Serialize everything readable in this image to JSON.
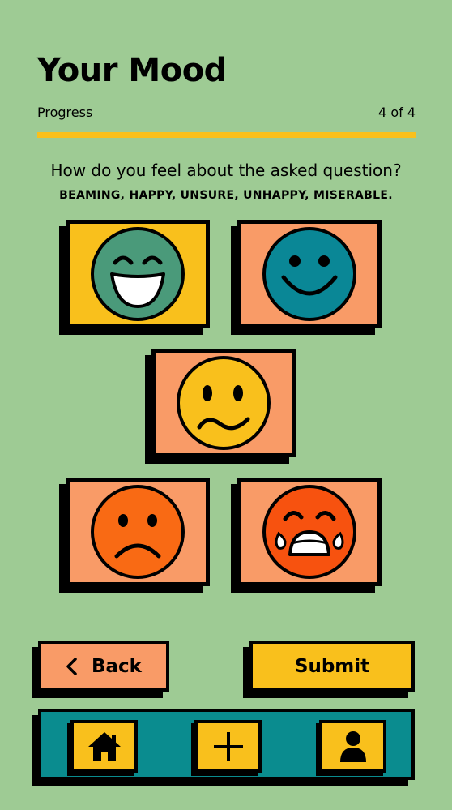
{
  "header": {
    "title": "Your Mood",
    "progress_label": "Progress",
    "progress_text": "4 of 4",
    "progress_fraction": 1.0
  },
  "question": {
    "text": "How do you feel about the asked question?",
    "options_hint": "BEAMING, HAPPY, UNSURE, UNHAPPY, MISERABLE."
  },
  "moods": [
    {
      "name": "beaming",
      "icon": "beaming-face-icon",
      "card_color": "#f9c01c",
      "face_color": "#4a9a7a",
      "selected": true
    },
    {
      "name": "happy",
      "icon": "smiling-face-icon",
      "card_color": "#f99b67",
      "face_color": "#0a8796",
      "selected": false
    },
    {
      "name": "unsure",
      "icon": "unsure-face-icon",
      "card_color": "#f99b67",
      "face_color": "#f9c01c",
      "selected": false
    },
    {
      "name": "unhappy",
      "icon": "frowning-face-icon",
      "card_color": "#f99b67",
      "face_color": "#f96a14",
      "selected": false
    },
    {
      "name": "miserable",
      "icon": "crying-face-icon",
      "card_color": "#f99b67",
      "face_color": "#f7520f",
      "selected": false
    }
  ],
  "actions": {
    "back_label": "Back",
    "submit_label": "Submit"
  },
  "nav": {
    "items": [
      {
        "icon": "home-icon"
      },
      {
        "icon": "plus-icon"
      },
      {
        "icon": "user-icon"
      }
    ]
  },
  "colors": {
    "background": "#9ecb94",
    "accent_yellow": "#f9c01c",
    "accent_orange": "#f99b67",
    "nav_teal": "#0a8c8f"
  }
}
